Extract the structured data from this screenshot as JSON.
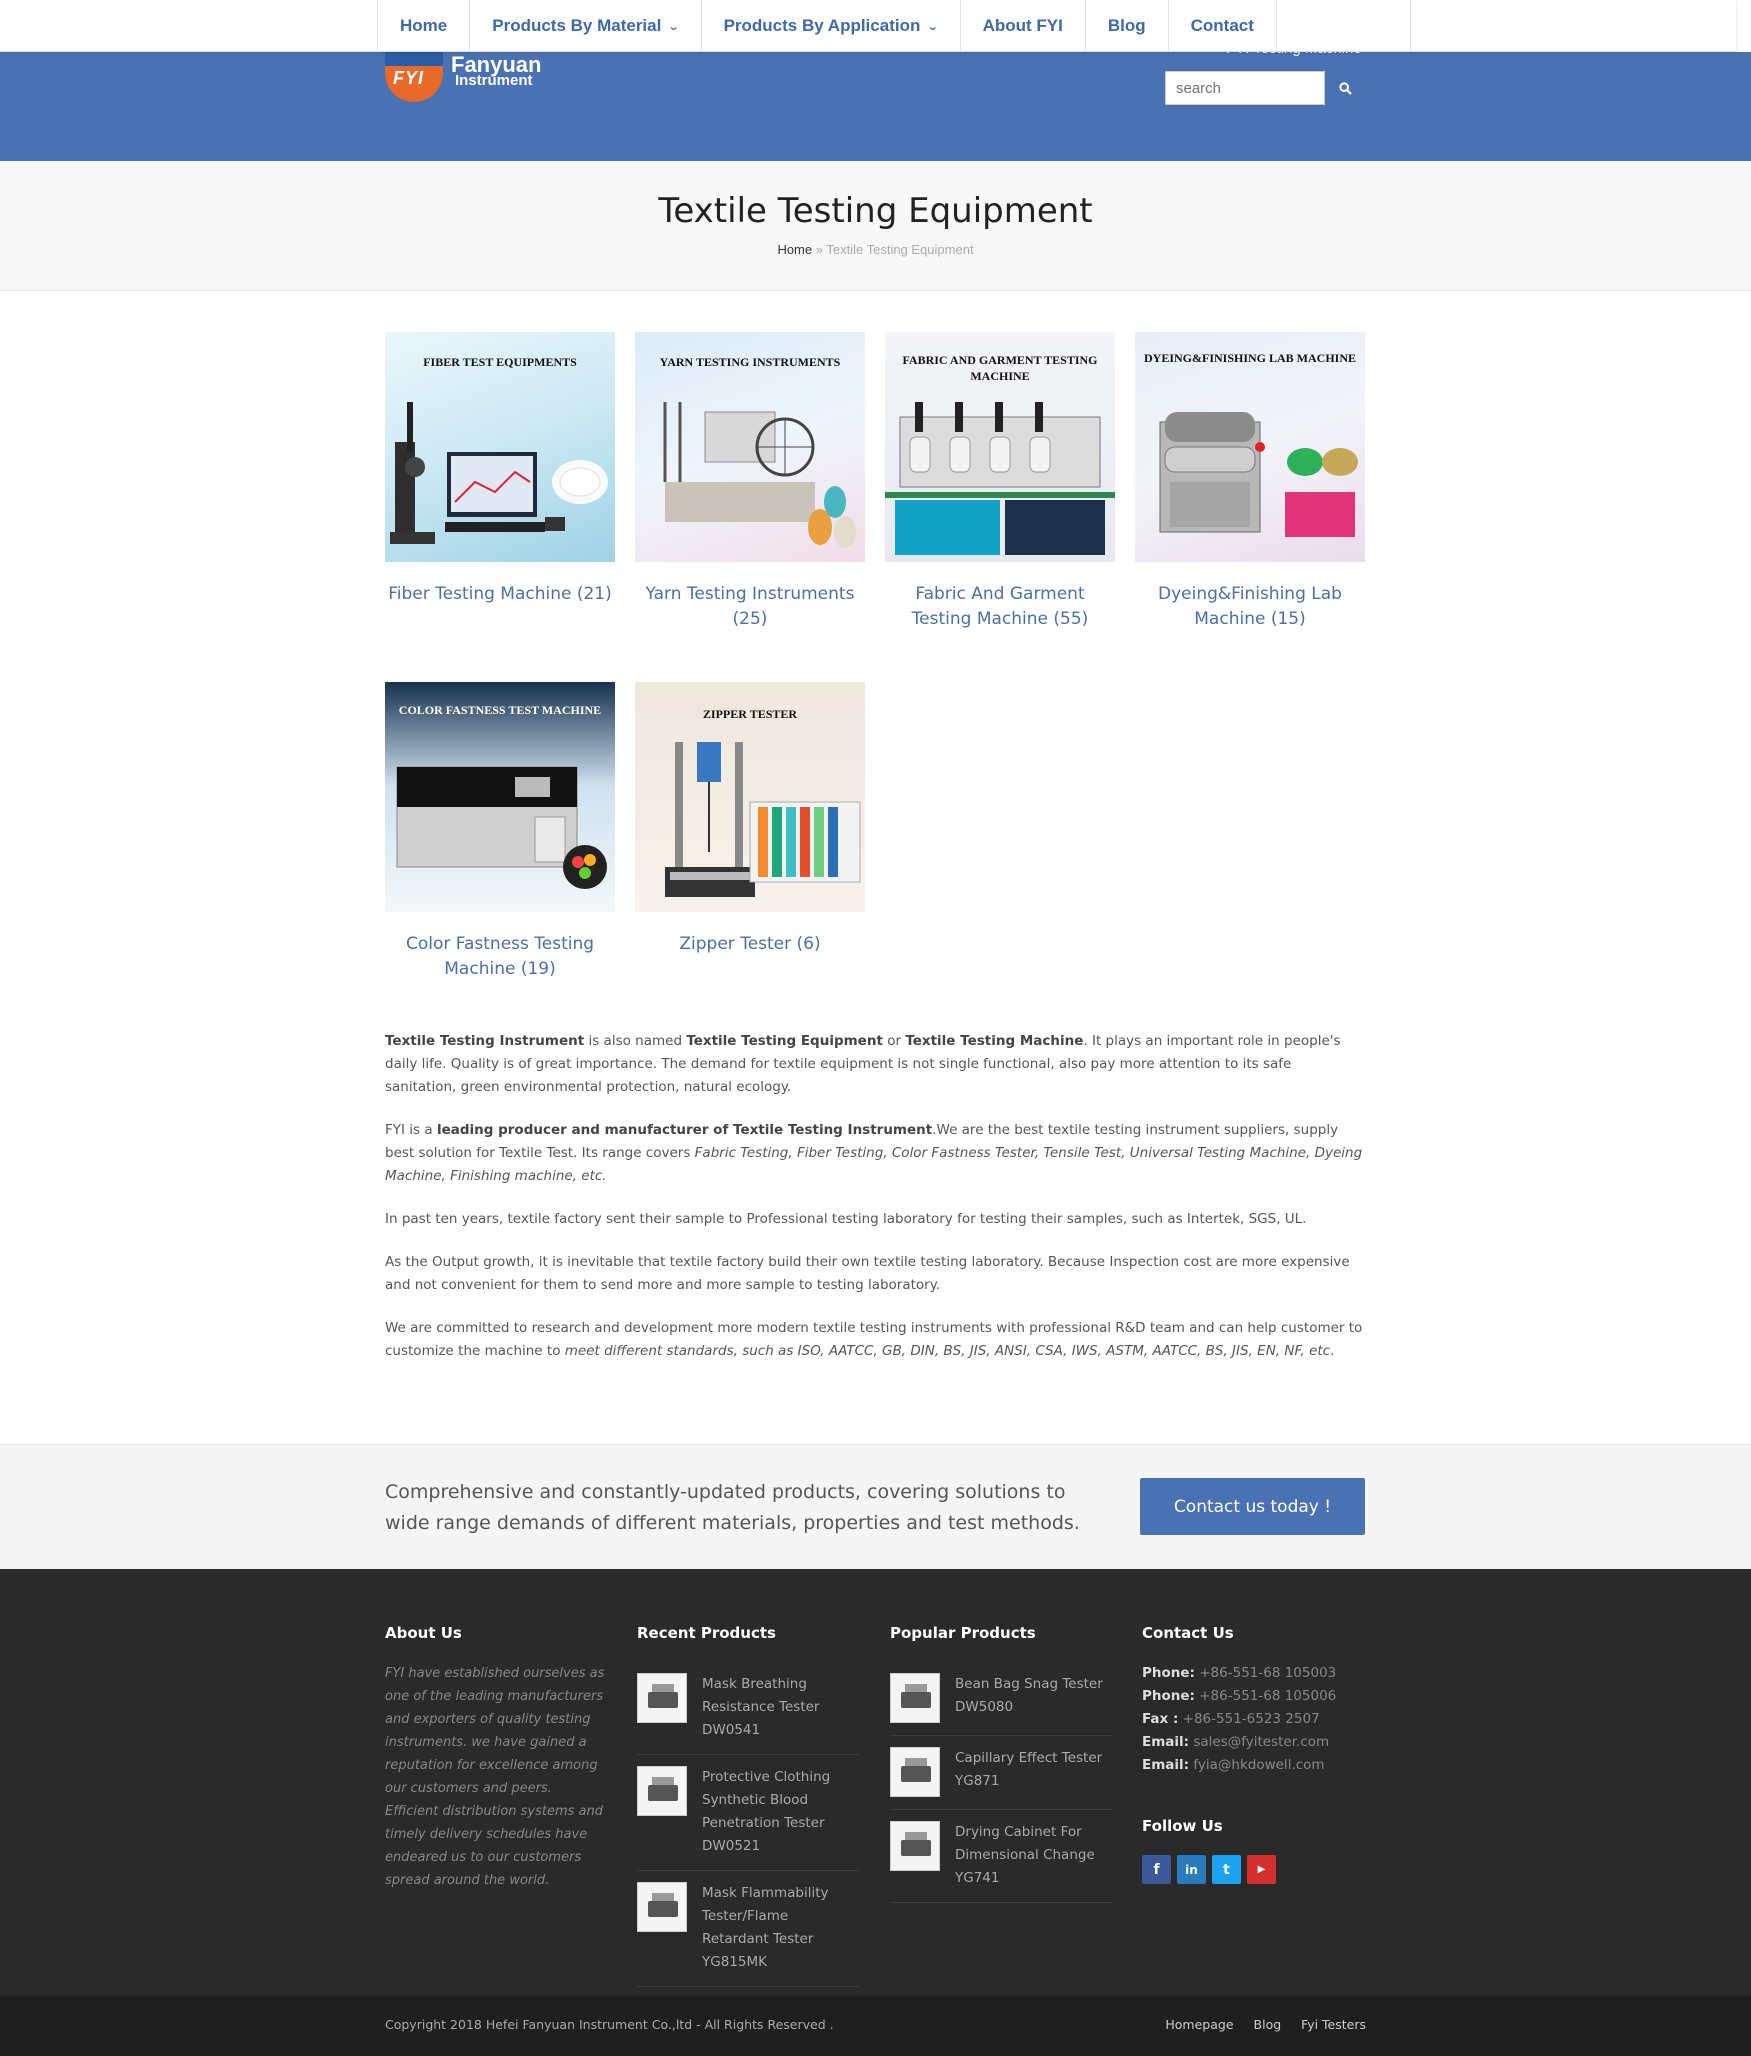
{
  "nav": {
    "items": [
      {
        "label": "Home",
        "dropdown": false
      },
      {
        "label": "Products By Material",
        "dropdown": true
      },
      {
        "label": "Products By Application",
        "dropdown": true
      },
      {
        "label": "About FYI",
        "dropdown": false
      },
      {
        "label": "Blog",
        "dropdown": false
      },
      {
        "label": "Contact",
        "dropdown": false
      }
    ]
  },
  "header": {
    "logo_mark": "FYI",
    "logo_name": "Fanyuan",
    "logo_sub": "Instrument",
    "tagline": "FYI Testing Machine",
    "search_placeholder": "search",
    "accent": "#4a72b3"
  },
  "page": {
    "title": "Textile Testing Equipment",
    "breadcrumb_home": "Home",
    "breadcrumb_sep": "»",
    "breadcrumb_current": "Textile Testing Equipment"
  },
  "categories": [
    {
      "img_label": "Fiber Test Equipments",
      "name": "Fiber Testing Machine (21)"
    },
    {
      "img_label": "Yarn Testing Instruments",
      "name": "Yarn Testing Instruments (25)"
    },
    {
      "img_label": "Fabric and Garment Testing Machine",
      "name": "Fabric And Garment Testing Machine (55)"
    },
    {
      "img_label": "Dyeing&Finishing Lab Machine",
      "name": "Dyeing&Finishing Lab Machine (15)"
    },
    {
      "img_label": "Color Fastness Test Machine",
      "name": "Color Fastness Testing Machine (19)"
    },
    {
      "img_label": "Zipper Tester",
      "name": "Zipper Tester (6)"
    }
  ],
  "description": {
    "p1_b1": "Textile Testing Instrument",
    "p1_t1": " is also named ",
    "p1_b2": "Textile Testing Equipment",
    "p1_t2": " or ",
    "p1_b3": "Textile Testing Machine",
    "p1_t3": ". It plays an important role in people's daily life. Quality is of great importance. The demand for textile equipment is not single functional, also pay more attention to its safe sanitation, green environmental protection, natural ecology.",
    "p2_t1": "FYI is a ",
    "p2_b1": "leading producer and manufacturer of Textile Testing Instrument",
    "p2_t2": ".We are the best textile testing instrument suppliers, supply best solution for Textile Test. Its range covers ",
    "p2_i1": "Fabric Testing, Fiber Testing, Color Fastness Tester, Tensile Test, Universal Testing Machine, Dyeing Machine, Finishing machine, etc.",
    "p3": "In past ten years, textile factory sent their sample to Professional testing laboratory for testing their samples, such as Intertek, SGS, UL.",
    "p4": "As the Output growth, it is inevitable that textile factory build their own textile testing laboratory. Because Inspection cost are more expensive and not convenient for them to send more and more sample to testing laboratory.",
    "p5_t1": "We are committed to research and development more modern textile testing instruments with professional R&D team and can help customer to customize the machine to ",
    "p5_i1": "meet different standards, such as ISO, AATCC, GB, DIN, BS, JIS, ANSI, CSA, IWS, ASTM, AATCC, BS, JIS, EN, NF, etc",
    "p5_t2": "."
  },
  "cta": {
    "text": "Comprehensive and constantly-updated products, covering solutions to wide range demands of different materials, properties and test methods.",
    "button": "Contact us today !"
  },
  "footer": {
    "about_title": "About Us",
    "about_text": "FYI have established ourselves as one of the leading manufacturers and exporters of quality testing instruments. we have gained a reputation for excellence among our customers and peers. Efficient distribution systems and timely delivery schedules have endeared us to our customers spread around the world.",
    "recent_title": "Recent Products",
    "recent": [
      "Mask Breathing Resistance Tester DW0541",
      "Protective Clothing Synthetic Blood Penetration Tester DW0521",
      "Mask Flammability Tester/Flame Retardant Tester YG815MK"
    ],
    "popular_title": "Popular Products",
    "popular": [
      "Bean Bag Snag Tester DW5080",
      "Capillary Effect Tester YG871",
      "Drying Cabinet For Dimensional Change YG741"
    ],
    "contact_title": "Contact Us",
    "contacts": [
      {
        "label": "Phone:",
        "value": "+86-551-68 105003"
      },
      {
        "label": "Phone:",
        "value": "+86-551-68 105006"
      },
      {
        "label": "Fax :",
        "value": "+86-551-6523 2507"
      },
      {
        "label": "Email:",
        "value": "sales@fyitester.com"
      },
      {
        "label": "Email:",
        "value": "fyia@hkdowell.com"
      }
    ],
    "follow_title": "Follow Us",
    "socials": [
      {
        "icon": "facebook-icon",
        "glyph": "f",
        "color": "#3b5998"
      },
      {
        "icon": "linkedin-icon",
        "glyph": "in",
        "color": "#2a7bbb"
      },
      {
        "icon": "twitter-icon",
        "glyph": "t",
        "color": "#1da1f2"
      },
      {
        "icon": "youtube-icon",
        "glyph": "▶",
        "color": "#d32f2f"
      }
    ]
  },
  "bottom": {
    "copyright": "Copyright 2018 Hefei Fanyuan Instrument Co.,ltd - All Rights Reserved .",
    "links": [
      "Homepage",
      "Blog",
      "Fyi Testers"
    ]
  }
}
